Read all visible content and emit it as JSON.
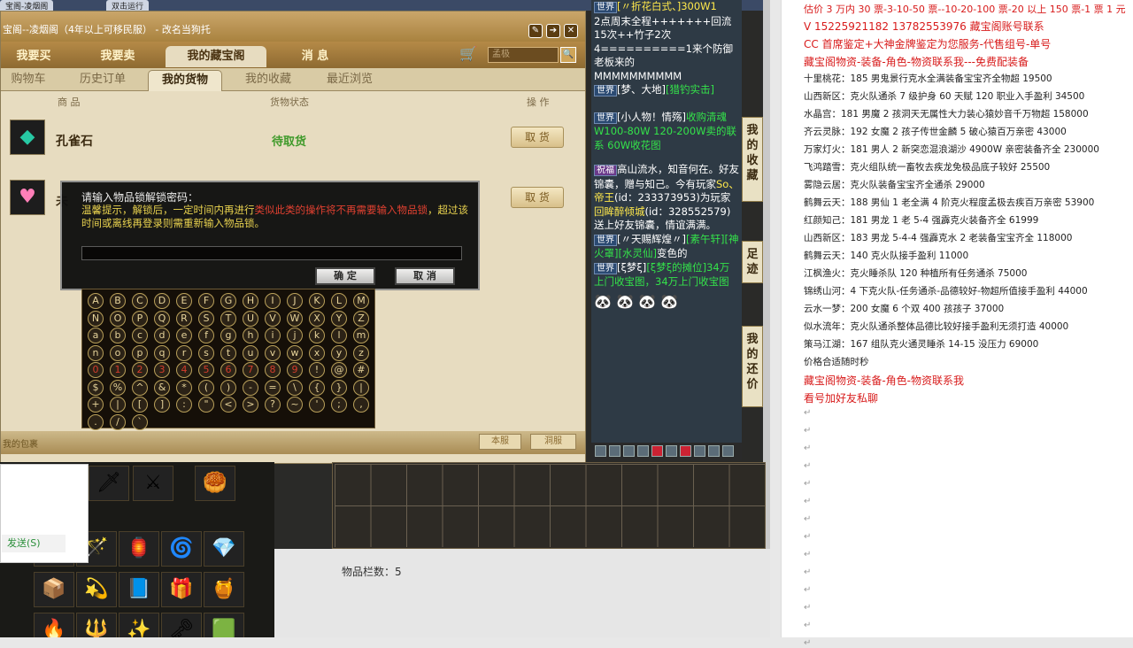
{
  "tabs": {
    "t1": "宝阁-凌烟阁",
    "t2": "双击运行"
  },
  "window": {
    "title": "宝阁--凌烟阁（4年以上可移民服） - 改名当狗托",
    "btn_a": "✎",
    "btn_b": "➔",
    "btn_c": "✕"
  },
  "nav": {
    "buy": "我要买",
    "sell": "我要卖",
    "vault": "我的藏宝阁",
    "msg": "消 息",
    "search_placeholder": "孟极"
  },
  "subnav": {
    "cart": "购物车",
    "history": "历史订单",
    "goods": "我的货物",
    "fav": "我的收藏",
    "recent": "最近浏览"
  },
  "columns": {
    "item": "商 品",
    "status": "货物状态",
    "op": "操 作"
  },
  "items": [
    {
      "name": "孔雀石",
      "status": "待取货",
      "action": "取 货"
    },
    {
      "name": "未",
      "status": "",
      "action": "取 货"
    }
  ],
  "bottom": {
    "left": "我的包裹",
    "btn1": "本服",
    "btn2": "洞服"
  },
  "dialog": {
    "prompt": "请输入物品锁解锁密码：",
    "hint_a": "温馨提示，解锁后，一定时间内再进行",
    "hint_red": "类似此类的操作将不再需要输入物品锁",
    "hint_b": "，超过该时间或离线再登录则需重新输入物品锁。",
    "ok": "确 定",
    "cancel": "取 消"
  },
  "keyboard": {
    "row1": [
      "A",
      "B",
      "C",
      "D",
      "E",
      "F",
      "G",
      "H",
      "I",
      "J",
      "K",
      "L",
      "M"
    ],
    "row2": [
      "N",
      "O",
      "P",
      "Q",
      "R",
      "S",
      "T",
      "U",
      "V",
      "W",
      "X",
      "Y",
      "Z"
    ],
    "row3": [
      "a",
      "b",
      "c",
      "d",
      "e",
      "f",
      "g",
      "h",
      "i",
      "j",
      "k",
      "l",
      "m"
    ],
    "row4": [
      "n",
      "o",
      "p",
      "q",
      "r",
      "s",
      "t",
      "u",
      "v",
      "w",
      "x",
      "y",
      "z"
    ],
    "row5": [
      "0",
      "1",
      "2",
      "3",
      "4",
      "5",
      "6",
      "7",
      "8",
      "9",
      "!",
      "@",
      "#"
    ],
    "row6": [
      "$",
      "%",
      "^",
      "&",
      "*",
      "(",
      ")",
      "-",
      "=",
      "\\",
      "{",
      "}",
      "|"
    ],
    "row7": [
      "+",
      "|",
      "[",
      "]",
      ":",
      "\"",
      "<",
      ">",
      "?",
      "~",
      "'",
      ";",
      ","
    ],
    "row8": [
      ".",
      "/",
      "`"
    ]
  },
  "chat": {
    "w": "世界",
    "l1": "[〃折花白式、]300W1",
    "l2": "2点周末全程+++++++回流15次++竹子2次4==========1来个防御老板来的",
    "l3": "MMMMMMMMMM",
    "l4_name": "[梦、大地]",
    "l4_msg": "[猎钓实击]",
    "l5_name": "[小人物！情殇]",
    "l5_msg": "收购清魂W100-80W 120-200W卖的联系",
    "l5_tail": "60W收花图",
    "blessing_tag": "祝福",
    "blessing": "高山流水，知音何在。好友锦囊，赠与知己。今有玩家",
    "bless_name1": "So、帝王",
    "bless_id1": "(id：233373953)为玩家",
    "bless_name2": "回眸醉倾城",
    "bless_id2": "(id：328552579)送上好友锦囊，情谊满满。",
    "l7_name": "[〃天赐辉煌〃]",
    "l7_msg": "[素午轩][神火罩][水灵仙]",
    "l7_tail": "变色的",
    "l8_name": "[ξ梦ξ]",
    "l8_msg": "[ξ梦ξ的摊位]34万上门收宝图，34万上门收宝图"
  },
  "sidetabs": {
    "t1": "我的收藏",
    "t2": "足迹",
    "t3": "我的还价"
  },
  "inventory": {
    "count": "物品栏数：5"
  },
  "send": "发送(S)",
  "doc": {
    "l1": "估价 3 万内 30 票-3-10-50 票--10-20-100 票-20 以上 150 票-1 票 1 元",
    "l2": "V 15225921182       13782553976   藏宝阁账号联系",
    "l3": "CC 首席鉴定+大神金牌鉴定为您服务-代售组号-单号",
    "l4": "藏宝阁物资-装备-角色-物资联系我---免费配装备",
    "entries": [
      "十里桃花：185 男鬼景行克水全满装备宝宝齐全物超 19500",
      "山西新区：克火队通杀 7 级护身 60 天赋 120 职业入手盈利 34500",
      "水晶宫：181 男魔 2 孩洞天无属性大力装心猿妙音千万物超 158000",
      "齐云灵脉：192 女魔 2 孩子传世金麟 5 破心猿百万亲密 43000",
      "万家灯火：181 男人 2 新突恋混浪湖沙 4900W 亲密装备齐全 230000",
      "飞鸿踏雪：克火组队统一畜牧去疾龙免极品底子较好 25500",
      "雾隐云居：克火队装备宝宝齐全通杀 29000",
      "鹤舞云天：188 男仙 1 老全满 4 阶克火程度孟极去疾百万亲密 53900",
      "红颜知己：181 男龙 1 老 5-4 强霹克火装备齐全 61999",
      "山西新区：183 男龙 5-4-4 强霹克水 2 老装备宝宝齐全 118000",
      "鹤舞云天：140 克火队接手盈利 11000",
      "江枫渔火：克火睡杀队 120 种植所有任务通杀 75000",
      "锦绣山河：4 下克火队-任务通杀-品德较好-物超所值接手盈利 44000",
      "云水一梦：200 女魔 6 个双 400 孩孩子 37000",
      "似水流年：克火队通杀整体品德比较好接手盈利无须打造 40000",
      "策马江湖：167 组队克火通灵睡杀 14-15 没压力 69000",
      "价格合适随时秒"
    ],
    "l_end1": "藏宝阁物资-装备-角色-物资联系我",
    "l_end2": "看号加好友私聊"
  },
  "colors": {
    "accent_gold": "#c9a15c",
    "status_green": "#3f9a2a",
    "doc_red": "#d81b1b"
  }
}
